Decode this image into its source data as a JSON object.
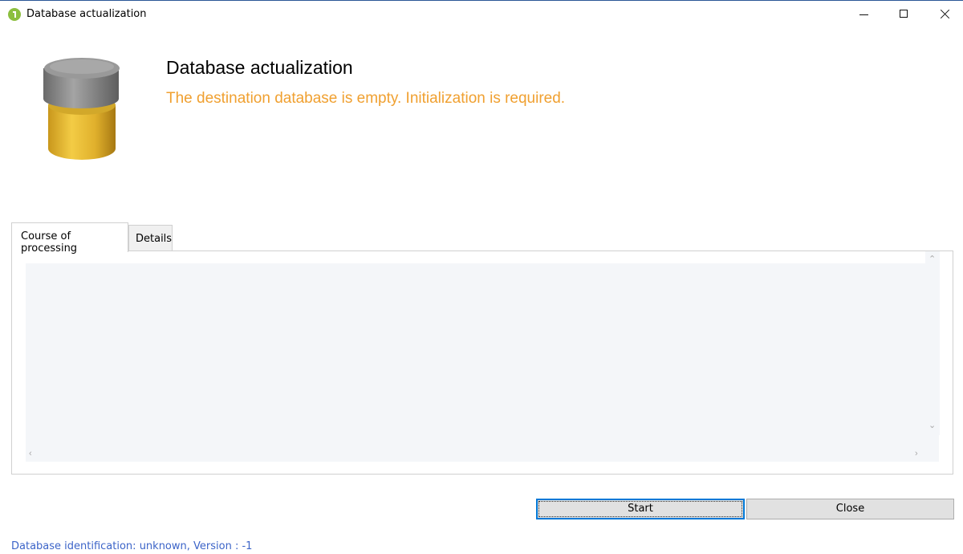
{
  "window": {
    "title": "Database actualization",
    "icon": "app-logo-icon"
  },
  "header": {
    "title": "Database actualization",
    "message": "The destination database is empty. Initialization is required.",
    "message_color": "#f0a030",
    "icon": "database-icon"
  },
  "tabs": [
    {
      "label": "Course of processing",
      "active": true
    },
    {
      "label": "Details",
      "active": false
    }
  ],
  "log": {
    "content": ""
  },
  "buttons": {
    "start_label": "Start",
    "close_label": "Close"
  },
  "status": {
    "text": "Database identification: unknown, Version : -1",
    "color": "#3c64c8"
  },
  "colors": {
    "accent": "#0078d7",
    "database_top": "#8a8a8a",
    "database_body": "#e8b82a"
  }
}
